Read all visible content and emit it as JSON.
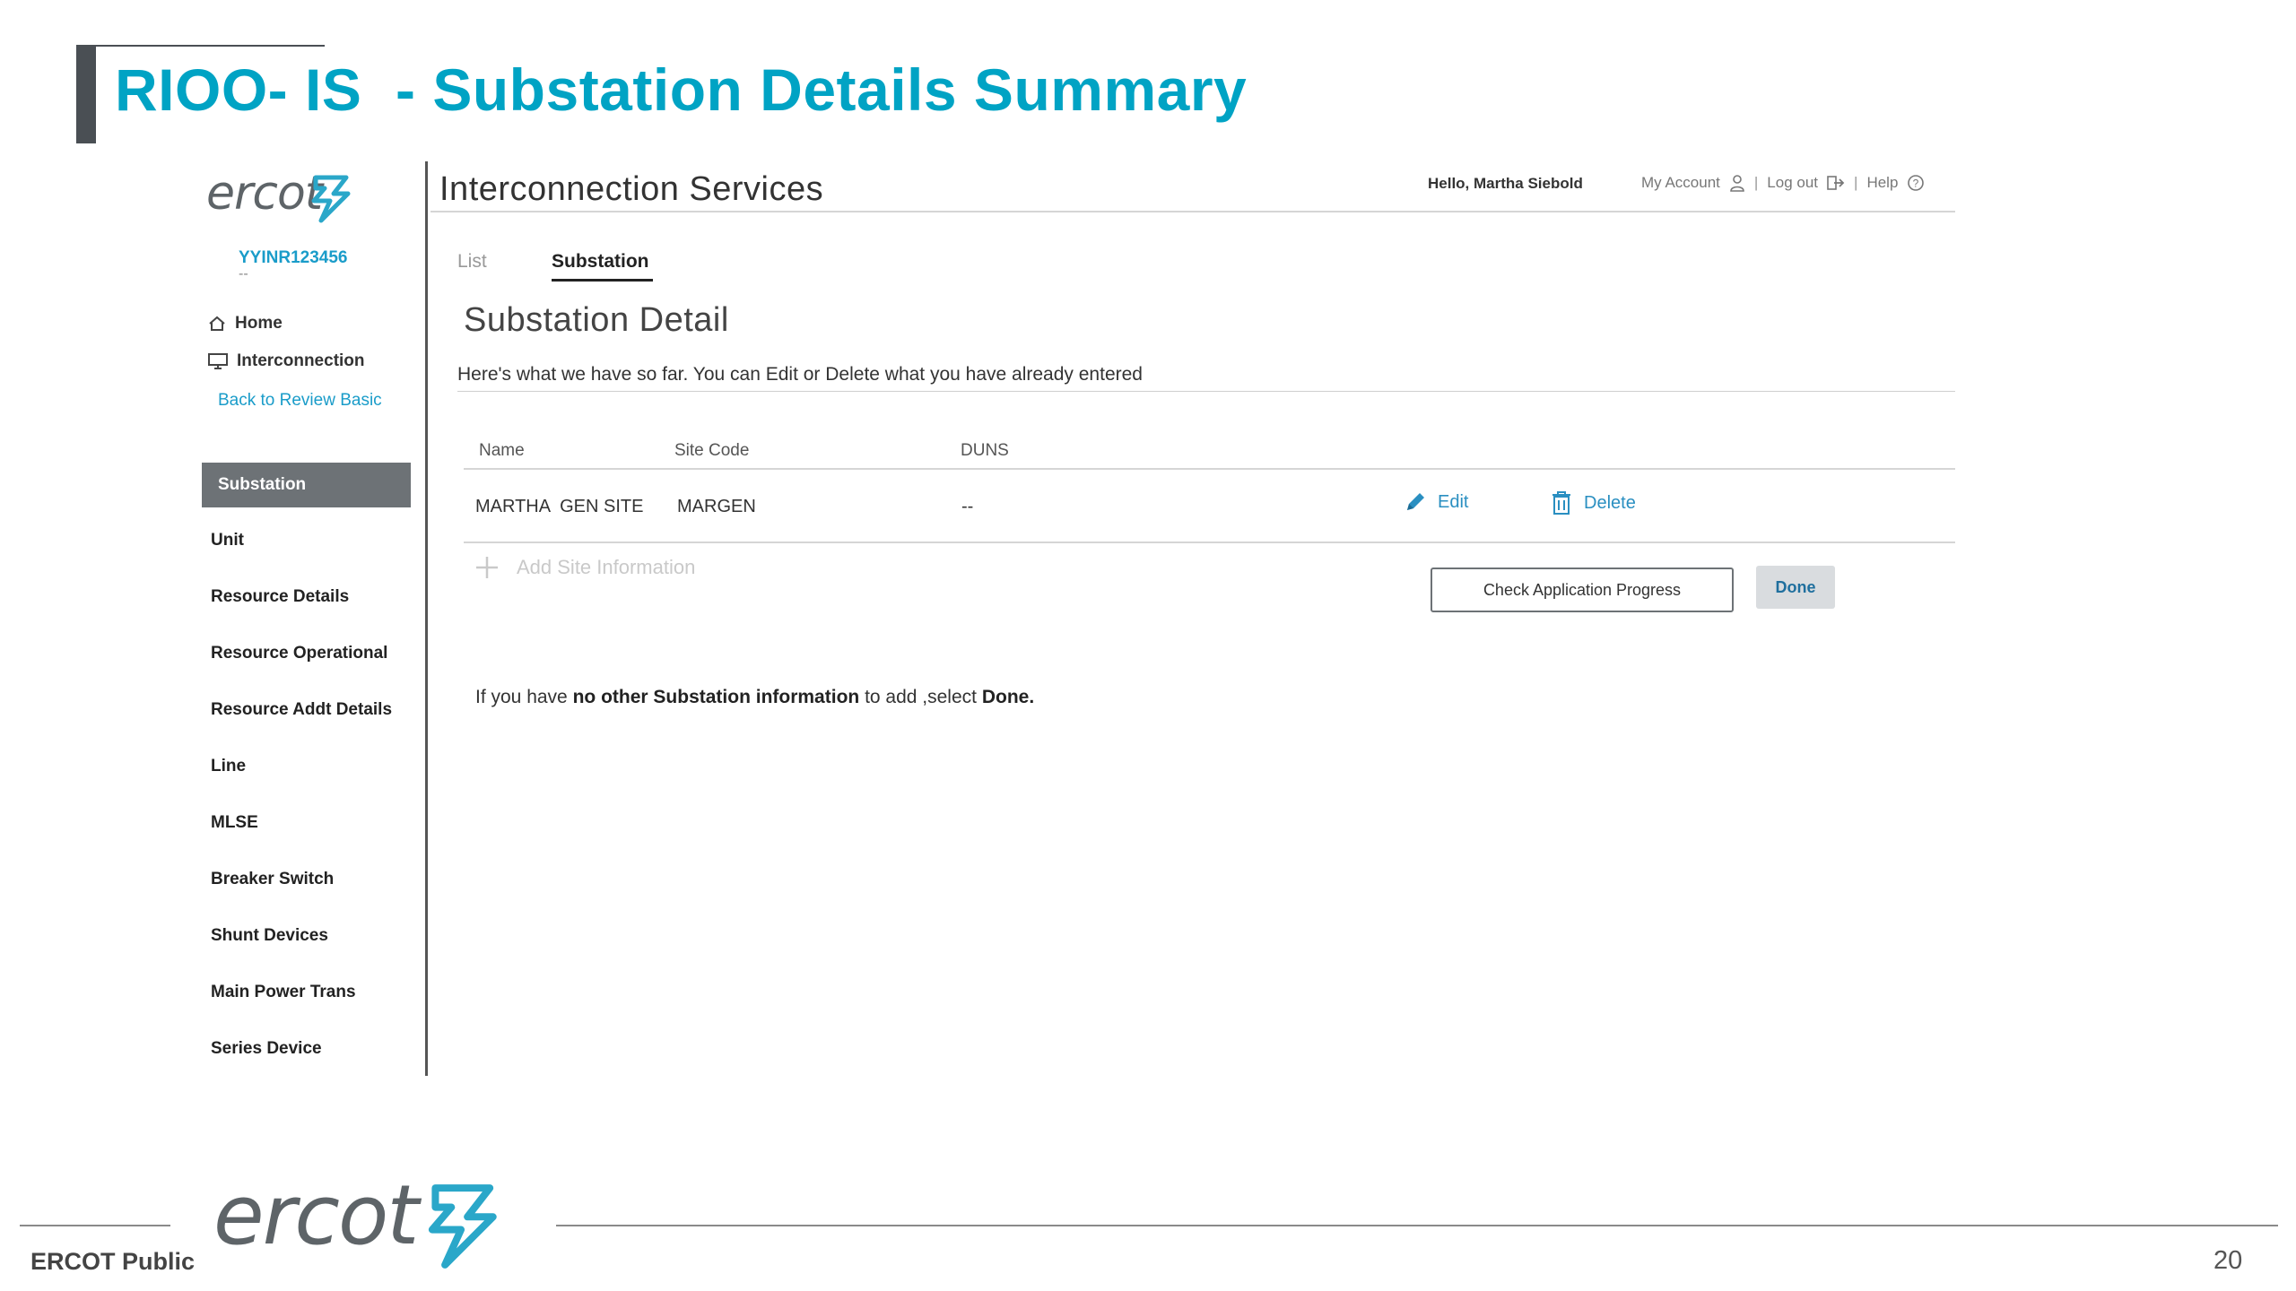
{
  "slide": {
    "title": "RIOO- IS  - Substation Details Summary",
    "footer_label": "ERCOT Public",
    "page_number": "20",
    "footer_logo_text": "ercot",
    "accent_color": "#00a3c4"
  },
  "sidebar": {
    "logo_text": "ercot",
    "application_id": "YYINR123456",
    "application_id_sub": "--",
    "links": [
      {
        "label": "Home",
        "icon": "home-icon"
      },
      {
        "label": "Interconnection",
        "icon": "monitor-icon"
      }
    ],
    "back_link": "Back to Review Basic",
    "active_item": "Substation",
    "items": [
      "Unit",
      "Resource Details",
      "Resource Operational",
      "Resource Addt Details",
      "Line",
      "MLSE",
      "Breaker Switch",
      "Shunt Devices",
      "Main Power Trans",
      "Series Device"
    ]
  },
  "header": {
    "title": "Interconnection Services",
    "greeting": "Hello, Martha Siebold",
    "my_account": "My Account",
    "logout": "Log out",
    "help": "Help",
    "separator": "|"
  },
  "tabs": {
    "list": "List",
    "substation": "Substation"
  },
  "detail": {
    "title": "Substation Detail",
    "intro": "Here's what we have so far. You can Edit or Delete what you have already entered",
    "columns": {
      "name": "Name",
      "site_code": "Site Code",
      "duns": "DUNS"
    },
    "row": {
      "name": "MARTHA  GEN SITE",
      "site_code": "MARGEN",
      "duns": "--"
    },
    "edit_label": "Edit",
    "delete_label": "Delete",
    "add_site_label": "Add Site Information",
    "check_progress_label": "Check Application Progress",
    "done_label": "Done",
    "note": {
      "prefix": "If you have ",
      "bold1": "no other Substation information",
      "middle": " to add ,select ",
      "bold2": "Done."
    }
  }
}
